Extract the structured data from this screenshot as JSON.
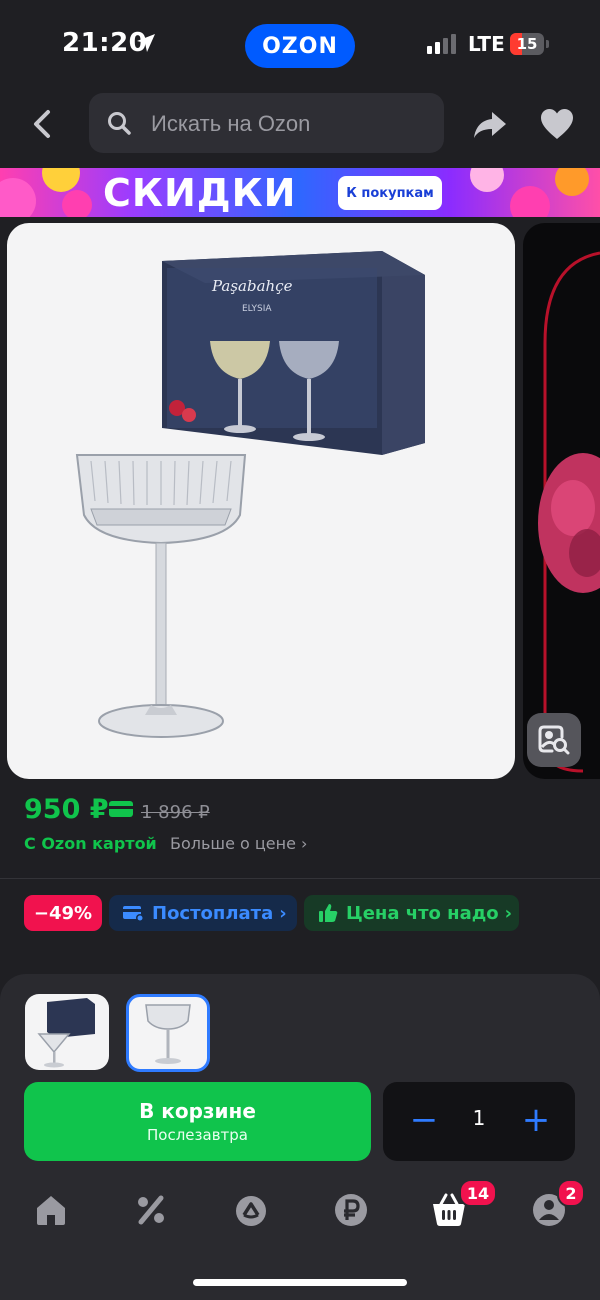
{
  "status_bar": {
    "time": "21:20",
    "brand": "OZON",
    "network": "LTE",
    "battery": "15"
  },
  "search": {
    "placeholder": "Искать на Ozon"
  },
  "banner": {
    "title": "СКИДКИ",
    "button": "К покупкам"
  },
  "product": {
    "price": "950 ₽",
    "old_price": "1 896 ₽",
    "card_price_label": "С Ozon картой",
    "more_price_label": "Больше о цене",
    "box_brand": "Paşabahçe",
    "box_model": "ELYSIA"
  },
  "chips": {
    "discount": "−49%",
    "postpay": "Постоплата",
    "fair_price": "Цена что надо"
  },
  "cart": {
    "label": "В корзине",
    "delivery": "Послезавтра",
    "quantity": "1"
  },
  "tab_bar": {
    "cart_badge": "14",
    "profile_badge": "2"
  },
  "colors": {
    "accent_green": "#10c44c",
    "brand_blue": "#005bff",
    "discount_red": "#f1124e"
  }
}
